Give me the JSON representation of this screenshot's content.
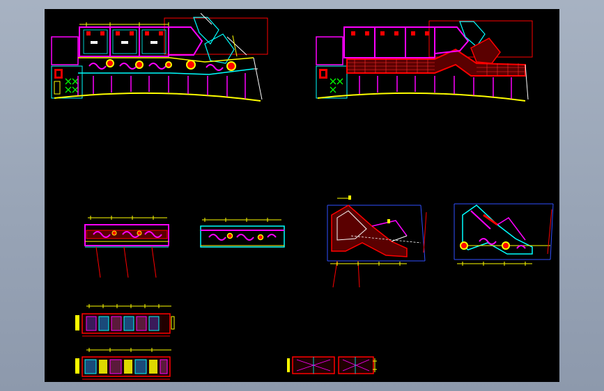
{
  "app": {
    "viewport": "cad-drawing-viewport"
  },
  "colors": {
    "background": "#000000",
    "frame": "#9aa6b8",
    "wall_magenta": "#ff00ff",
    "wall_cyan": "#00ffff",
    "wall_yellow": "#ffff00",
    "wall_red": "#ff0000",
    "wall_white": "#ffffff",
    "wall_blue": "#3050ff",
    "wall_green": "#00ff00"
  },
  "drawings": [
    {
      "id": "floor-plan-1",
      "kind": "floor-plan"
    },
    {
      "id": "floor-plan-2",
      "kind": "floor-plan-tiled"
    },
    {
      "id": "section-detail-1",
      "kind": "section"
    },
    {
      "id": "section-detail-2",
      "kind": "section"
    },
    {
      "id": "corner-detail-1",
      "kind": "corner-plan"
    },
    {
      "id": "corner-detail-2",
      "kind": "corner-plan"
    },
    {
      "id": "elevation-strip-1",
      "kind": "elevation"
    },
    {
      "id": "elevation-strip-2",
      "kind": "elevation"
    },
    {
      "id": "elevation-strip-3",
      "kind": "elevation"
    }
  ]
}
